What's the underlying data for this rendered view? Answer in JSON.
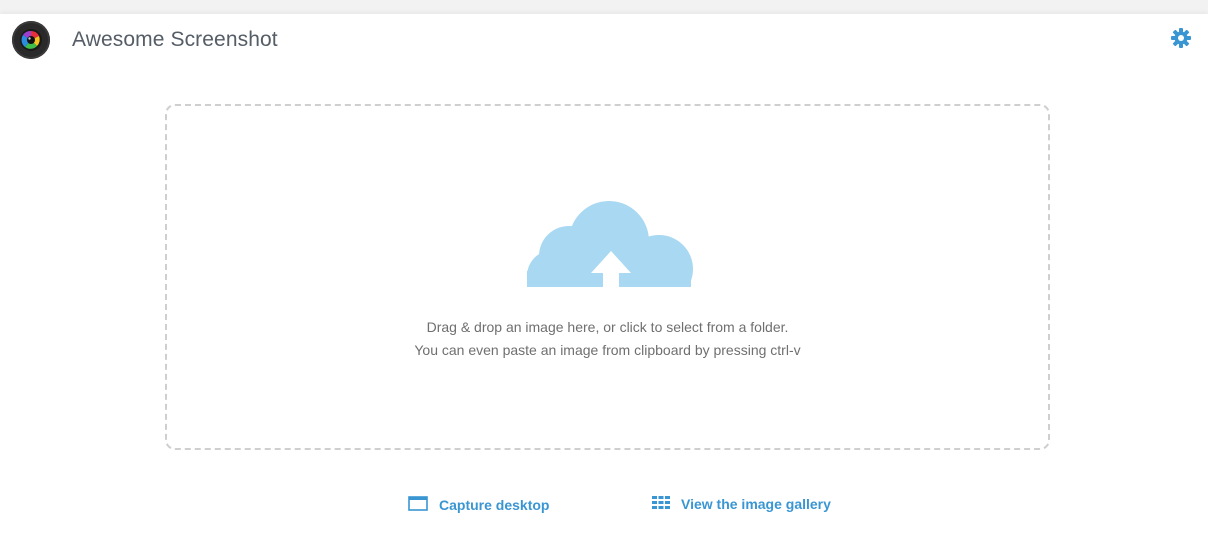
{
  "header": {
    "title": "Awesome Screenshot",
    "logo_icon": "camera-lens-icon",
    "settings_icon": "gear-icon"
  },
  "dropzone": {
    "icon": "cloud-upload-icon",
    "line1": "Drag & drop an image here, or click to select from a folder.",
    "line2": "You can even paste an image from clipboard by pressing ctrl-v"
  },
  "actions": {
    "capture_label": "Capture desktop",
    "capture_icon": "window-icon",
    "gallery_label": "View the image gallery",
    "gallery_icon": "grid-icon"
  },
  "colors": {
    "accent": "#3a96d3",
    "cloud": "#a8d8f2",
    "text": "#6f6f6f",
    "title": "#555d66"
  }
}
